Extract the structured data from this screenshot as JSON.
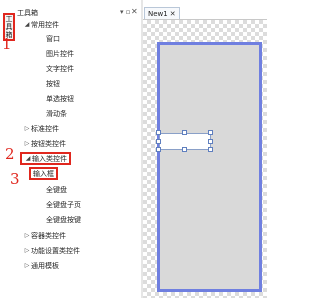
{
  "side_tab": {
    "label_chars": [
      "工",
      "具",
      "箱"
    ]
  },
  "panel": {
    "title": "工具箱",
    "pin": "▾ ▫",
    "close": "✕"
  },
  "tree": {
    "common": {
      "label": "常用控件",
      "items": [
        "窗口",
        "图片控件",
        "文字控件",
        "按钮",
        "单选按钮",
        "滑动条"
      ]
    },
    "standard": {
      "label": "标准控件"
    },
    "button_class": {
      "label": "按钮类控件"
    },
    "input_class": {
      "label": "输入类控件",
      "items": [
        "输入框",
        "全键盘",
        "全键盘子页",
        "全键盘按键"
      ]
    },
    "container_class": {
      "label": "容器类控件"
    },
    "function_class": {
      "label": "功能设置类控件"
    },
    "common_templates": {
      "label": "通用模板"
    }
  },
  "annotations": {
    "n1": "1",
    "n2": "2",
    "n3": "3"
  },
  "document": {
    "tab_label": "New1",
    "tab_close": "✕"
  },
  "colors": {
    "highlight": "#e0271e",
    "page_border": "#6f7fe0",
    "page_fill": "#d9d9d9"
  }
}
